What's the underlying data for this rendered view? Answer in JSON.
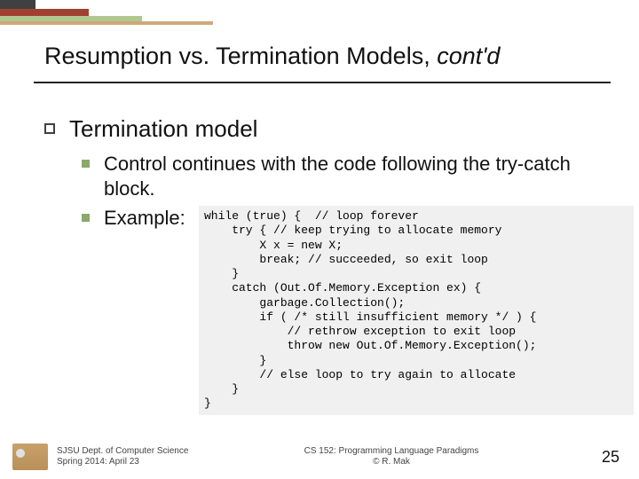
{
  "header": {
    "title_main": "Resumption vs. Termination Models, ",
    "title_italic": "cont'd"
  },
  "body": {
    "lvl1": "Termination model",
    "points": [
      "Control continues with the code following the try-catch block.",
      "Example:"
    ]
  },
  "code": "while (true) {  // loop forever\n    try { // keep trying to allocate memory\n        X x = new X;\n        break; // succeeded, so exit loop\n    }\n    catch (Out.Of.Memory.Exception ex) {\n        garbage.Collection();\n        if ( /* still insufficient memory */ ) {\n            // rethrow exception to exit loop\n            throw new Out.Of.Memory.Exception();\n        }\n        // else loop to try again to allocate\n    }\n}",
  "footer": {
    "left_line1": "SJSU Dept. of Computer Science",
    "left_line2": "Spring 2014: April 23",
    "center_line1": "CS 152: Programming Language Paradigms",
    "center_line2": "© R. Mak",
    "page": "25"
  }
}
